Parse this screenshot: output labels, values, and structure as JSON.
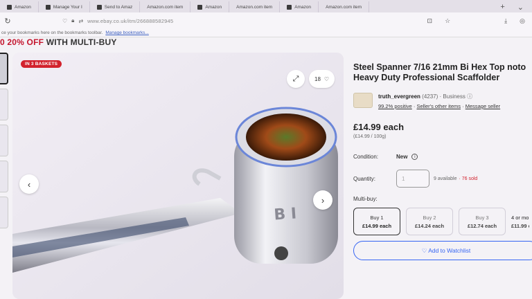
{
  "browser": {
    "tabs": [
      {
        "label": "Amazon"
      },
      {
        "label": "Manage Your I"
      },
      {
        "label": "Send to Amaz"
      },
      {
        "label": "Amazon.com item"
      },
      {
        "label": "Amazon"
      },
      {
        "label": "Amazon.com item"
      },
      {
        "label": "Amazon"
      },
      {
        "label": "Amazon.com item"
      }
    ],
    "new_tab": "+",
    "tab_list": "⌄",
    "url": "www.ebay.co.uk/itm/266888582945",
    "bookmarks_msg": "ce your bookmarks here on the bookmarks toolbar.",
    "bookmarks_link": "Manage bookmarks..."
  },
  "page": {
    "promo_highlight": "0 20% OFF",
    "promo_rest": " WITH MULTI-BUY",
    "badge": "IN 3 BASKETS",
    "watch_count": "18",
    "title_line1": "Steel Spanner 7/16 21mm Bi Hex Top noto",
    "title_line2": "Heavy Duty Professional Scaffolder",
    "seller_name": "truth_evergreen",
    "seller_count": "(4237)",
    "seller_type": "· Business",
    "seller_positive": "99.2% positive",
    "seller_other": "Seller's other items",
    "seller_contact": "Message seller",
    "price": "£14.99 each",
    "price_per": "(£14.99 / 100g)",
    "condition_label": "Condition:",
    "condition_value": "New",
    "quantity_label": "Quantity:",
    "quantity_value": "1",
    "available": "9 available",
    "sold": "· 76 sold",
    "multibuy_label": "Multi-buy:",
    "multibuy": [
      {
        "label": "Buy 1",
        "price": "£14.99 each"
      },
      {
        "label": "Buy 2",
        "price": "£14.24 each"
      },
      {
        "label": "Buy 3",
        "price": "£12.74 each"
      },
      {
        "label": "4 or mo",
        "price": "£11.99 e"
      }
    ],
    "watchlist_button": "♡ Add to Watchlist",
    "sep1": "·",
    "sep2": "·"
  },
  "colors": {
    "badge": "#d2222d",
    "link": "#3665f3",
    "sold": "#d2222d"
  }
}
